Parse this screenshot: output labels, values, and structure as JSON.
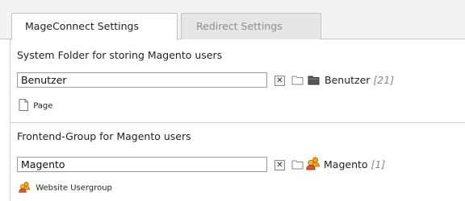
{
  "tabs": [
    {
      "label": "MageConnect Settings",
      "active": true
    },
    {
      "label": "Redirect Settings",
      "active": false
    }
  ],
  "sections": [
    {
      "title": "System Folder for storing Magento users",
      "input_value": "Benutzer",
      "clear_symbol": "✕",
      "record_label": "Benutzer",
      "record_count": "[21]",
      "record_icon": "folder-icon",
      "type_label": "Page",
      "type_icon": "page-icon"
    },
    {
      "title": "Frontend-Group for Magento users",
      "input_value": "Magento",
      "clear_symbol": "✕",
      "record_label": "Magento",
      "record_count": "[1]",
      "record_icon": "usergroup-icon",
      "type_label": "Website Usergroup",
      "type_icon": "usergroup-icon"
    }
  ],
  "colors": {
    "tabbar_bg": "#f3f3f3",
    "inactive_tab_bg": "#e6e6e6",
    "folder_dark": "#555555",
    "user_orange": "#f0a21c"
  }
}
